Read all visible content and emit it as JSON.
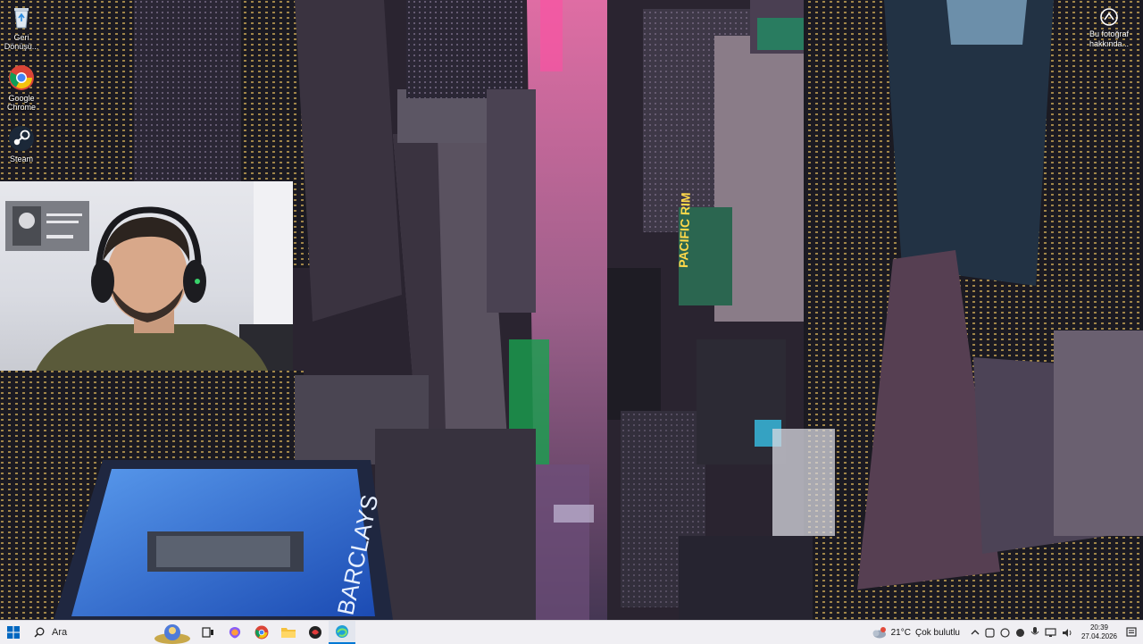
{
  "desktop": {
    "icons": [
      {
        "label": "Geri Dönüşü...",
        "icon": "recycle-bin-icon"
      },
      {
        "label": "Google Chrome",
        "icon": "chrome-icon"
      },
      {
        "label": "Steam",
        "icon": "steam-icon"
      }
    ],
    "about_photo": {
      "label": "Bu fotoğraf hakkında...",
      "icon": "info-icon"
    },
    "wallpaper_billboard": "PACIFIC RIM",
    "wallpaper_sign": "BARCLAYS"
  },
  "taskbar": {
    "search_placeholder": "Ara",
    "apps": [
      "start-icon",
      "search-icon",
      "widgets-icon",
      "task-view-icon",
      "copilot-icon",
      "chrome-icon",
      "file-explorer-icon",
      "app-icon",
      "edge-icon"
    ],
    "weather": {
      "temp": "21°C",
      "condition": "Çok bulutlu"
    },
    "clock": {
      "time": "20:39",
      "date": "27.04.2026"
    }
  },
  "colors": {
    "taskbar_bg": "#f0eff3",
    "accent": "#0078d4"
  }
}
